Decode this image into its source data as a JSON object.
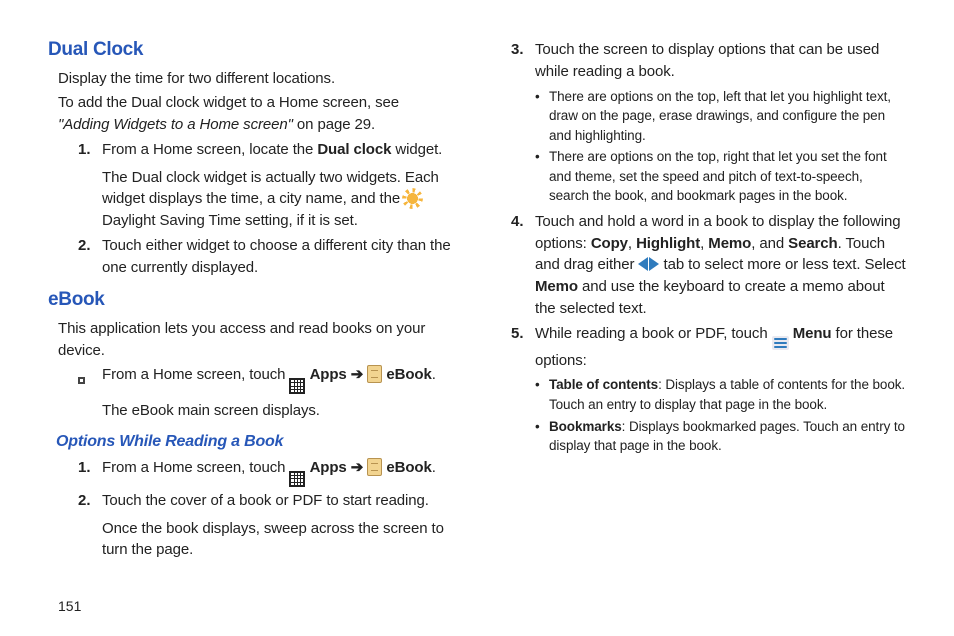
{
  "page_number": "151",
  "left": {
    "h1": "Dual Clock",
    "p1": "Display the time for two different locations.",
    "p2a": "To add the Dual clock widget to a Home screen, see ",
    "p2b": "\"Adding Widgets to a Home screen\"",
    "p2c": " on page 29.",
    "n1a": "From a Home screen, locate the ",
    "n1b": "Dual clock",
    "n1c": " widget.",
    "n1d": "The Dual clock widget is actually two widgets. Each widget displays the time, a city name, and the ",
    "n1e": " Daylight Saving Time setting, if it is set.",
    "n2": "Touch either widget to choose a different city than the one currently displayed.",
    "h2": "eBook",
    "p3": "This application lets you access and read books on your device.",
    "sq1a": "From a Home screen, touch ",
    "apps": "Apps",
    "arrow": "➔",
    "ebook": "eBook",
    "period": ".",
    "sq1c": "The eBook main screen displays.",
    "h3": "Options While Reading a Book",
    "rn1a": "From a Home screen, touch ",
    "rn2": "Touch the cover of a book or PDF to start reading.",
    "rn2b": "Once the book displays, sweep across the screen to turn the page."
  },
  "right": {
    "n3": "Touch the screen to display options that can be used while reading a book.",
    "b3a": "There are options on the top, left that let you highlight text, draw on the page, erase drawings, and configure the pen and highlighting.",
    "b3b": "There are options on the top, right that let you set the font and theme, set the speed and pitch of text-to-speech, search the book, and bookmark pages in the book.",
    "n4a": "Touch and hold a word in a book to display the following options: ",
    "copy": "Copy",
    "highlight": "Highlight",
    "memo": "Memo",
    "search": "Search",
    "n4b": ". Touch and drag either ",
    "n4c": " tab to select more or less text. Select ",
    "n4d": " and use the keyboard to create a memo about the selected text.",
    "n5a": "While reading a book or PDF, touch ",
    "menu": "Menu",
    "n5b": " for these options:",
    "b5a_t": "Table of contents",
    "b5a": ": Displays a table of contents for the book. Touch an entry to display that page in the book.",
    "b5b_t": "Bookmarks",
    "b5b": ": Displays bookmarked pages. Touch an entry to display that page in the book."
  }
}
